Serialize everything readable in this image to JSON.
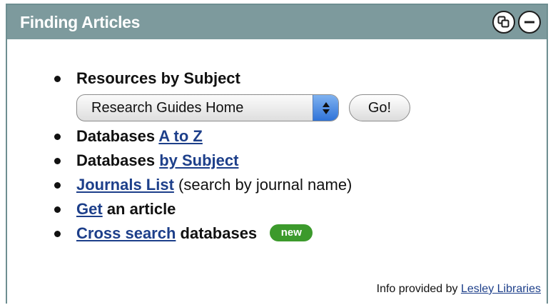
{
  "header": {
    "title": "Finding Articles"
  },
  "items": {
    "resources_label": "Resources by Subject",
    "select_value": "Research Guides Home",
    "go_label": "Go!",
    "databases_prefix": "Databases",
    "a_to_z_link": "A to Z",
    "databases_prefix_2": "Databases",
    "by_subject_link": "by Subject",
    "journals_link": "Journals List",
    "journals_note": "(search by journal name)",
    "get_link": "Get",
    "get_suffix": "an article",
    "cross_search_link": "Cross search",
    "cross_search_suffix": "databases",
    "new_badge": "new"
  },
  "footer": {
    "prefix": "Info provided by",
    "link": "Lesley Libraries"
  },
  "icons": {
    "copy": "copy-icon",
    "collapse": "minus-icon"
  },
  "colors": {
    "header_bg": "#7d9a9d",
    "link": "#1d3f8a",
    "badge": "#3c9a2c"
  }
}
